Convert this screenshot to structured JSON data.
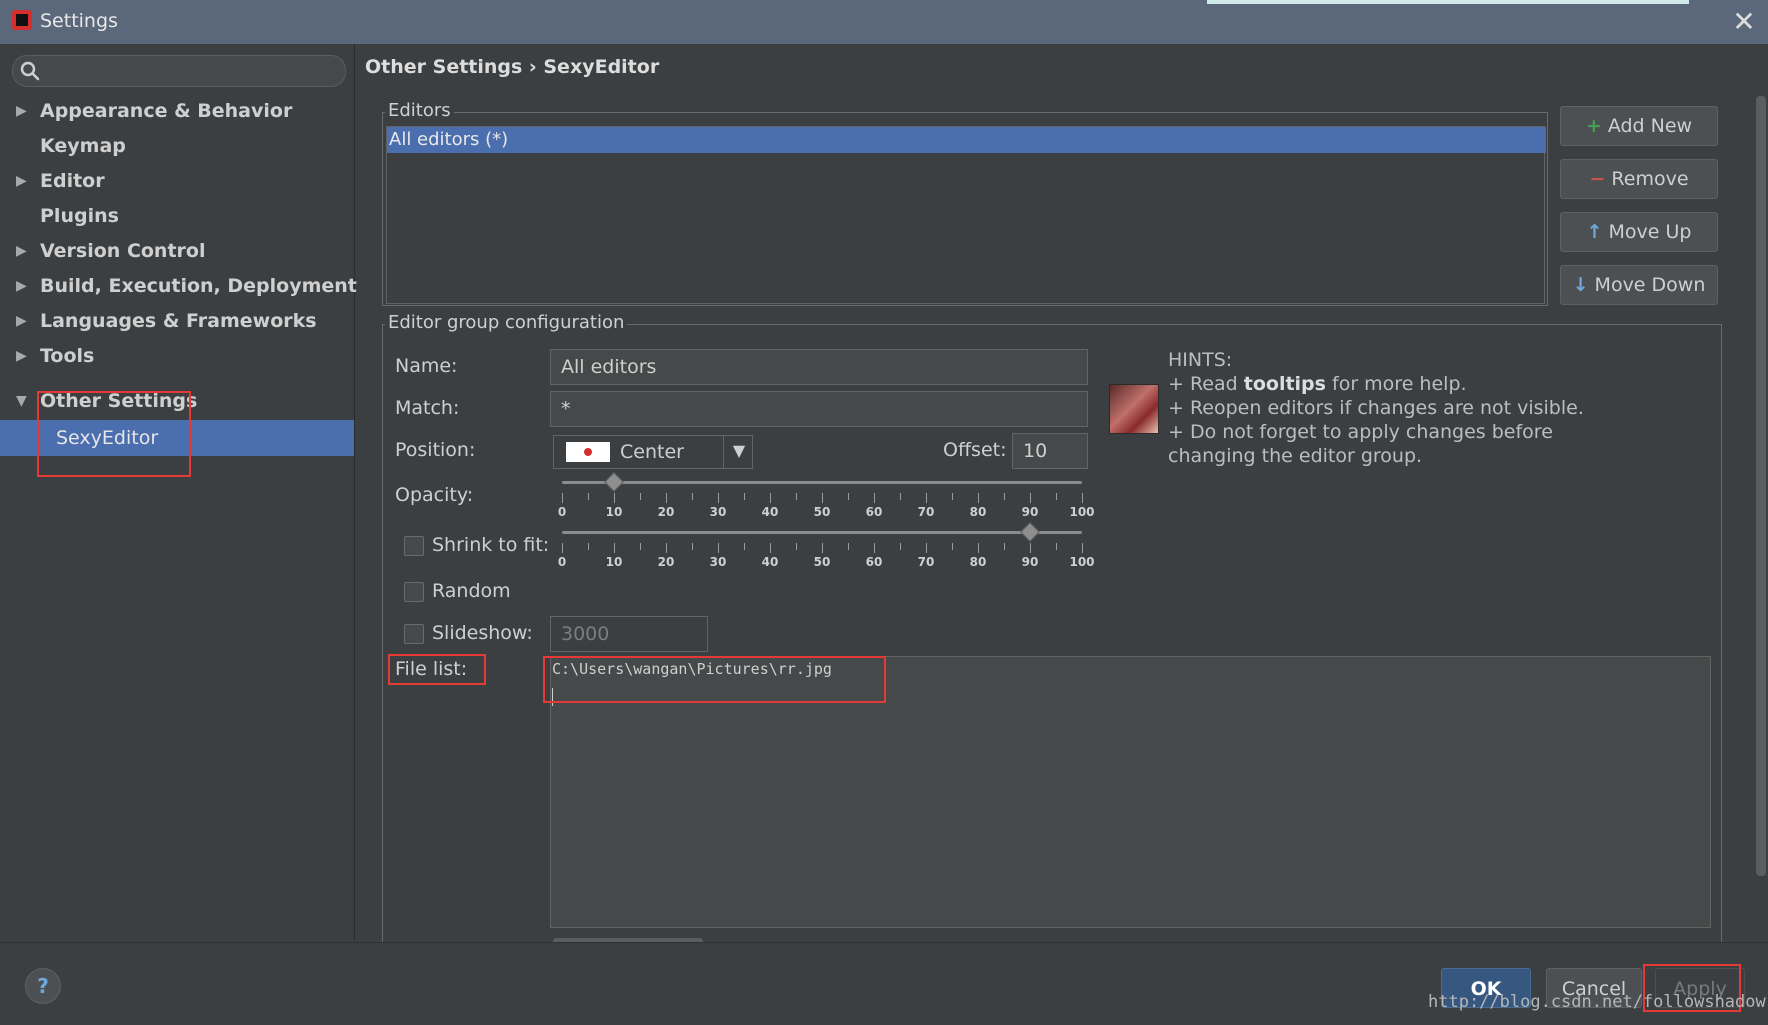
{
  "window": {
    "title": "Settings",
    "close_glyph": "✕"
  },
  "colors": {
    "accent_selection": "#4b6eaf",
    "annotation_red": "#e53935",
    "ok_button": "#365880"
  },
  "sidebar": {
    "search": {
      "value": "",
      "icon": "search-icon"
    },
    "items": [
      {
        "label": "Appearance & Behavior",
        "arrow": "▶"
      },
      {
        "label": "Keymap",
        "arrow": ""
      },
      {
        "label": "Editor",
        "arrow": "▶"
      },
      {
        "label": "Plugins",
        "arrow": ""
      },
      {
        "label": "Version Control",
        "arrow": "▶"
      },
      {
        "label": "Build, Execution, Deployment",
        "arrow": "▶"
      },
      {
        "label": "Languages & Frameworks",
        "arrow": "▶"
      },
      {
        "label": "Tools",
        "arrow": "▶"
      },
      {
        "label": "Other Settings",
        "arrow": "▼"
      },
      {
        "label": "SexyEditor",
        "arrow": "",
        "selected": true
      }
    ]
  },
  "main": {
    "breadcrumb": "Other Settings › SexyEditor",
    "editors_group": {
      "title": "Editors",
      "rows": [
        "All editors (*)"
      ],
      "buttons": [
        {
          "icon": "+",
          "label": "Add New"
        },
        {
          "icon": "−",
          "label": "Remove"
        },
        {
          "icon": "↑",
          "label": "Move Up"
        },
        {
          "icon": "↓",
          "label": "Move Down"
        }
      ]
    },
    "config_group": {
      "title": "Editor group configuration",
      "name_label": "Name:",
      "name_value": "All editors",
      "match_label": "Match:",
      "match_value": "*",
      "position_label": "Position:",
      "position_value": "Center",
      "offset_label": "Offset:",
      "offset_value": "10",
      "opacity_label": "Opacity:",
      "opacity_value": 10,
      "shrink_label": "Shrink to fit:",
      "shrink_checked": false,
      "shrink_value": 90,
      "random_label": "Random",
      "random_checked": false,
      "slideshow_label": "Slideshow:",
      "slideshow_checked": false,
      "slideshow_value": "3000",
      "file_list_label": "File list:",
      "file_list_value": "C:\\Users\\wangan\\Pictures\\rr.jpg",
      "slider_ticks": [
        "0",
        "10",
        "20",
        "30",
        "40",
        "50",
        "60",
        "70",
        "80",
        "90",
        "100"
      ]
    },
    "hints": {
      "title": "HINTS:",
      "line1_prefix": "+ Read ",
      "line1_bold": "tooltips",
      "line1_suffix": " for more help.",
      "line2": "+ Reopen editors if changes are not visible.",
      "line3": "+ Do not forget to apply changes before",
      "line4": "changing the editor group."
    }
  },
  "footer": {
    "help_label": "?",
    "ok_label": "OK",
    "cancel_label": "Cancel",
    "apply_label": "Apply",
    "watermark": "http://blog.csdn.net/followshadow"
  }
}
